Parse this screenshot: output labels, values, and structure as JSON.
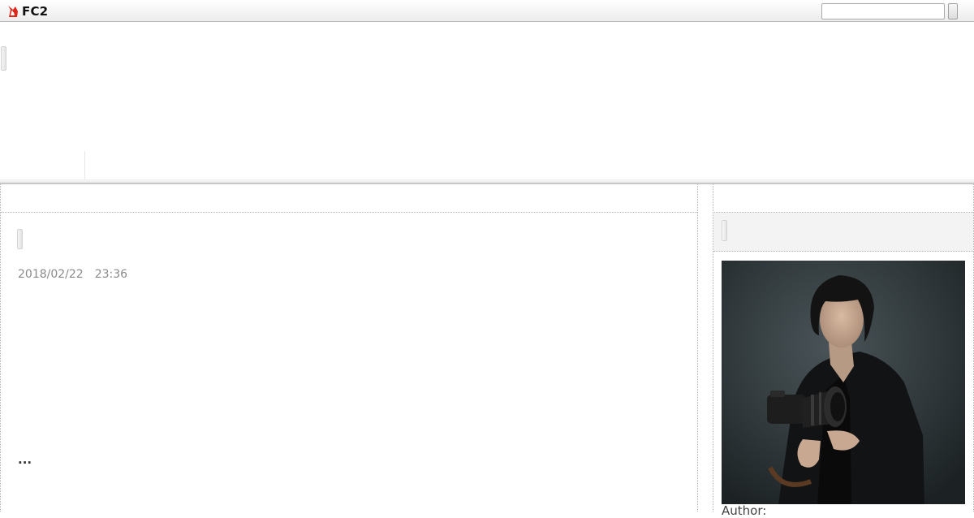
{
  "topbar": {
    "logo_text": "FC2",
    "logo_color": "#e0261b",
    "search_placeholder": ""
  },
  "entry": {
    "date": "2018/02/22",
    "time": "23:36",
    "more": "..."
  },
  "sidebar": {
    "author_label": "Author:"
  },
  "colors": {
    "page_bg": "#ffffff",
    "meta_text": "#8a8a8a",
    "border": "#b5b5b5",
    "side_head_bg": "#f3f3f3"
  }
}
